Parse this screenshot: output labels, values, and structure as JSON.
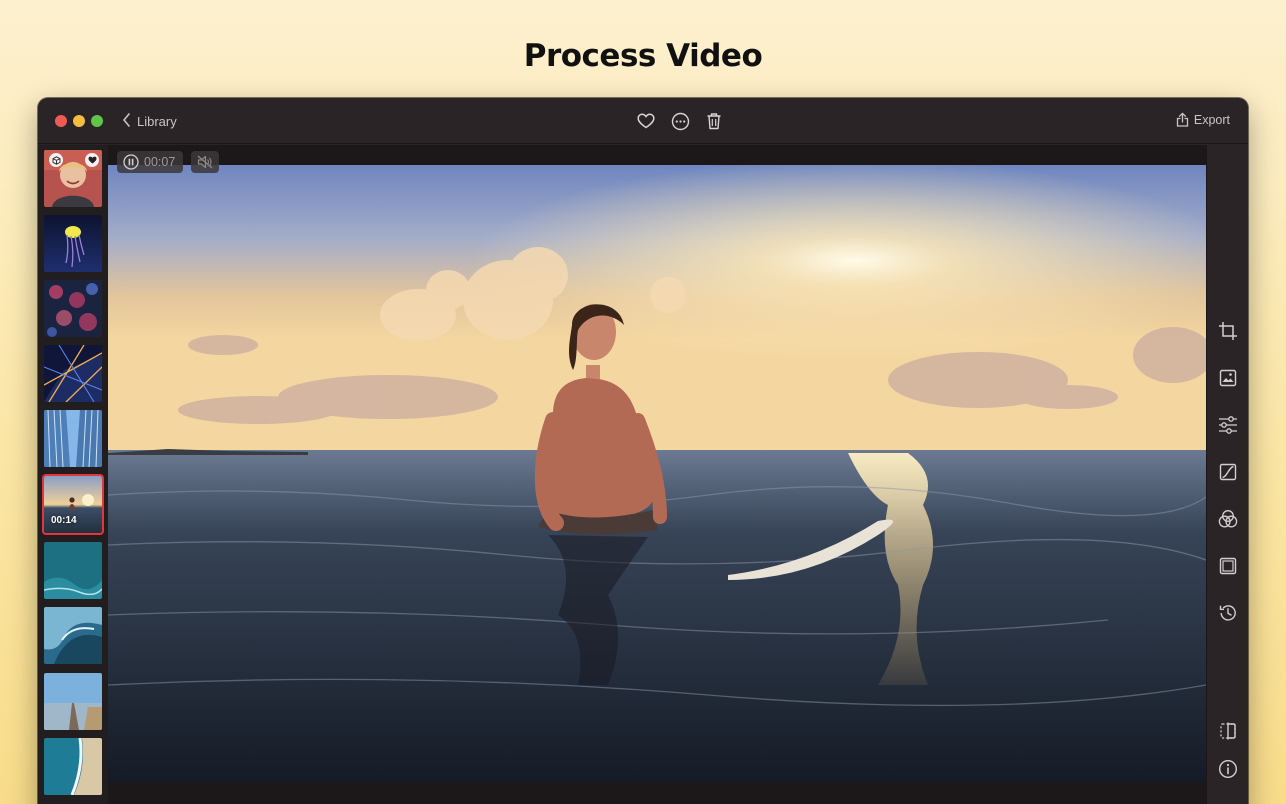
{
  "headline": "Process Video",
  "titlebar": {
    "back_label": "Library",
    "export_label": "Export"
  },
  "player": {
    "elapsed": "00:07"
  },
  "filmstrip": {
    "selected_duration": "00:14"
  },
  "icons": {
    "back": "chevron-left-icon",
    "favorite": "heart-icon",
    "more": "ellipsis-circle-icon",
    "delete": "trash-icon",
    "export": "share-icon",
    "pause": "pause-circle-icon",
    "mute": "speaker-muted-icon",
    "crop": "crop-icon",
    "frame": "image-frame-icon",
    "adjust": "sliders-icon",
    "curves": "curves-icon",
    "color": "color-circles-icon",
    "border": "border-icon",
    "history": "history-icon",
    "compare": "split-compare-icon",
    "info": "info-icon"
  },
  "colors": {
    "window_bg": "#2a2426",
    "selection": "#e2363c",
    "icon": "#c9c4c5"
  }
}
